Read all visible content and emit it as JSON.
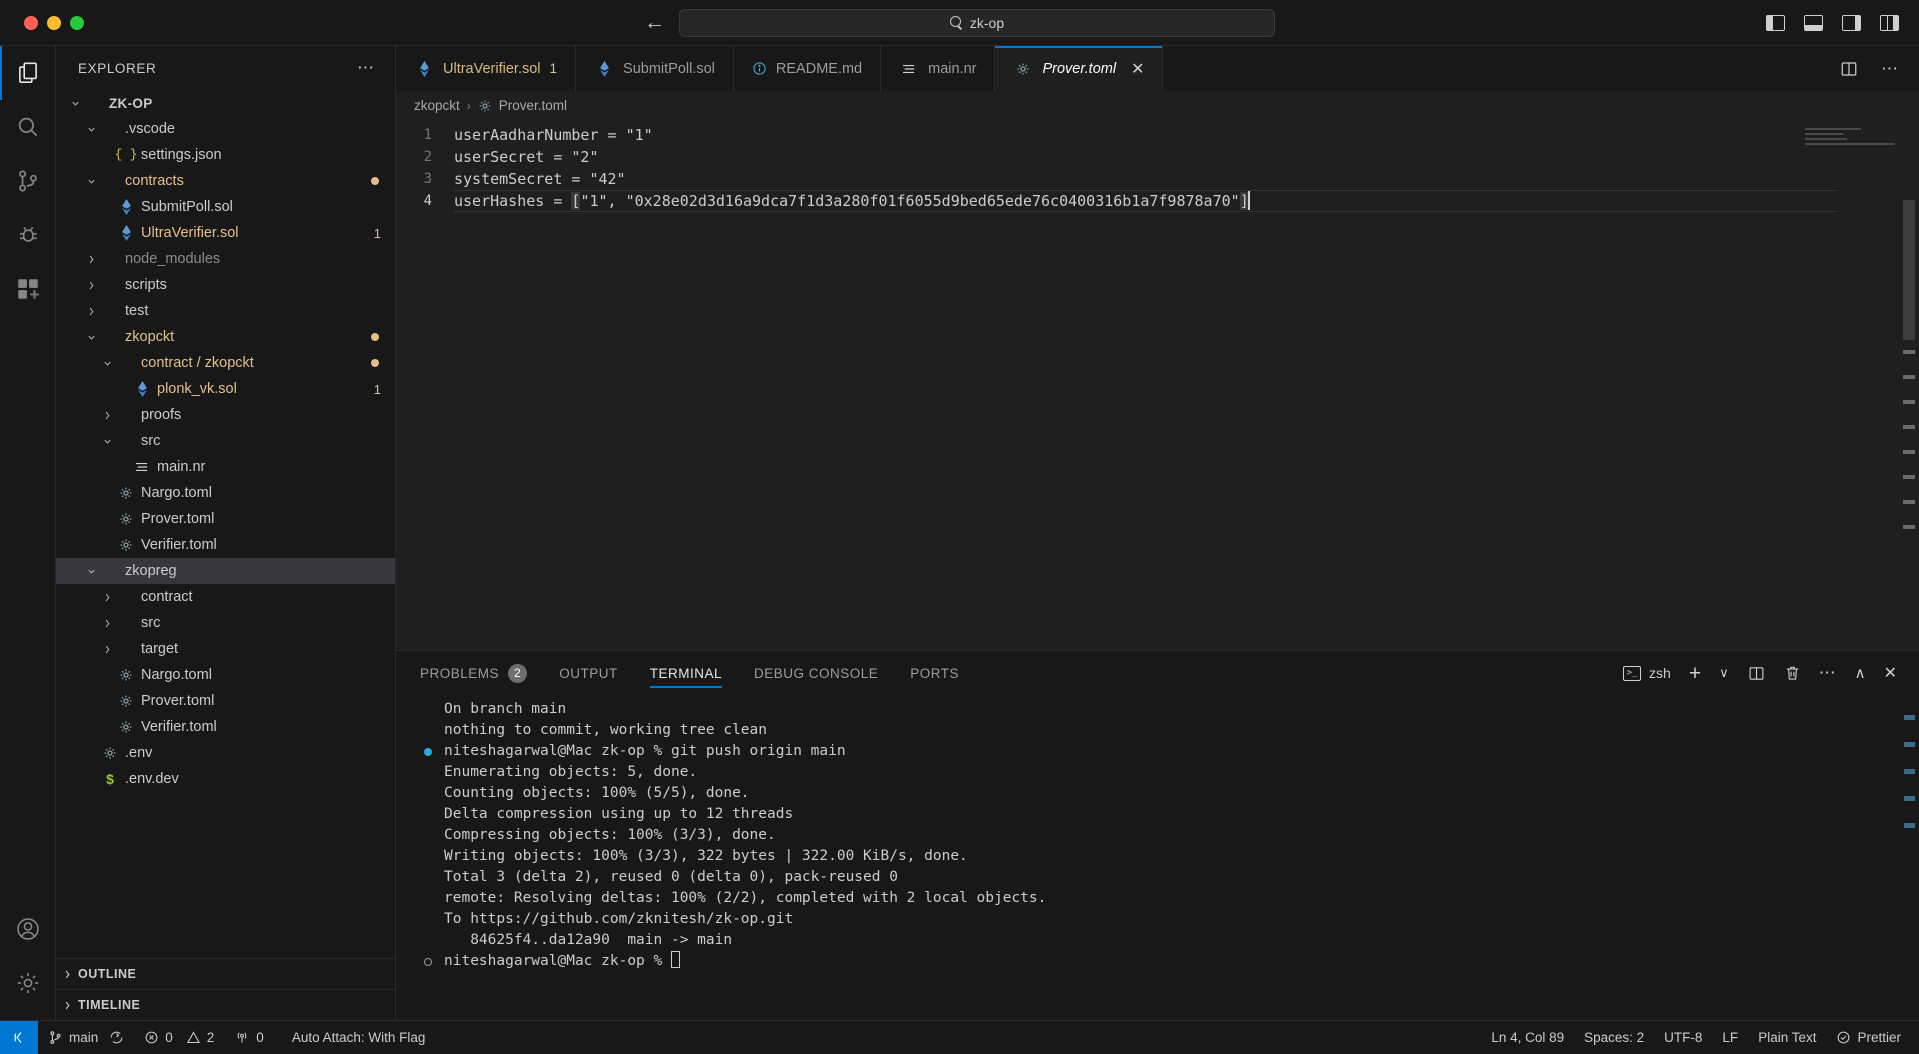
{
  "titlebar": {
    "search_text": "zk-op",
    "search_icon": "search-icon",
    "back_arrow": "←",
    "forward_arrow": "→"
  },
  "activitybar": {
    "items": [
      {
        "name": "explorer",
        "icon": "files-icon",
        "active": true
      },
      {
        "name": "search",
        "icon": "search-icon",
        "active": false
      },
      {
        "name": "source-control",
        "icon": "source-control-icon",
        "active": false
      },
      {
        "name": "run-and-debug",
        "icon": "debug-icon",
        "active": false
      },
      {
        "name": "extensions",
        "icon": "extensions-icon",
        "active": false
      }
    ],
    "bottom": [
      {
        "name": "accounts",
        "icon": "account-icon"
      },
      {
        "name": "settings",
        "icon": "gear-icon"
      }
    ]
  },
  "sidebar": {
    "title": "EXPLORER",
    "more_actions": "⋯",
    "tree": [
      {
        "label": "ZK-OP",
        "indent": 0,
        "type": "folder-root",
        "chev": "v",
        "icon": "none",
        "color": "white",
        "badge": "",
        "modified": false,
        "selected": false
      },
      {
        "label": ".vscode",
        "indent": 1,
        "type": "folder",
        "chev": "v",
        "icon": "none",
        "color": "white",
        "badge": "",
        "modified": false,
        "selected": false
      },
      {
        "label": "settings.json",
        "indent": 2,
        "type": "file",
        "chev": "",
        "icon": "json",
        "color": "white",
        "badge": "",
        "modified": false,
        "selected": false
      },
      {
        "label": "contracts",
        "indent": 1,
        "type": "folder",
        "chev": "v",
        "icon": "none",
        "color": "yellow",
        "badge": "",
        "modified": true,
        "selected": false
      },
      {
        "label": "SubmitPoll.sol",
        "indent": 2,
        "type": "file",
        "chev": "",
        "icon": "sol",
        "color": "white",
        "badge": "",
        "modified": false,
        "selected": false
      },
      {
        "label": "UltraVerifier.sol",
        "indent": 2,
        "type": "file",
        "chev": "",
        "icon": "sol",
        "color": "yellow",
        "badge": "1",
        "modified": false,
        "selected": false
      },
      {
        "label": "node_modules",
        "indent": 1,
        "type": "folder",
        "chev": ">",
        "icon": "none",
        "color": "dim",
        "badge": "",
        "modified": false,
        "selected": false
      },
      {
        "label": "scripts",
        "indent": 1,
        "type": "folder",
        "chev": ">",
        "icon": "none",
        "color": "white",
        "badge": "",
        "modified": false,
        "selected": false
      },
      {
        "label": "test",
        "indent": 1,
        "type": "folder",
        "chev": ">",
        "icon": "none",
        "color": "white",
        "badge": "",
        "modified": false,
        "selected": false
      },
      {
        "label": "zkopckt",
        "indent": 1,
        "type": "folder",
        "chev": "v",
        "icon": "none",
        "color": "yellow",
        "badge": "",
        "modified": true,
        "selected": false
      },
      {
        "label": "contract / zkopckt",
        "indent": 2,
        "type": "folder",
        "chev": "v",
        "icon": "none",
        "color": "yellow",
        "badge": "",
        "modified": true,
        "selected": false
      },
      {
        "label": "plonk_vk.sol",
        "indent": 3,
        "type": "file",
        "chev": "",
        "icon": "sol",
        "color": "yellow",
        "badge": "1",
        "modified": false,
        "selected": false
      },
      {
        "label": "proofs",
        "indent": 2,
        "type": "folder",
        "chev": ">",
        "icon": "none",
        "color": "white",
        "badge": "",
        "modified": false,
        "selected": false
      },
      {
        "label": "src",
        "indent": 2,
        "type": "folder",
        "chev": "v",
        "icon": "none",
        "color": "white",
        "badge": "",
        "modified": false,
        "selected": false
      },
      {
        "label": "main.nr",
        "indent": 3,
        "type": "file",
        "chev": "",
        "icon": "lines",
        "color": "white",
        "badge": "",
        "modified": false,
        "selected": false
      },
      {
        "label": "Nargo.toml",
        "indent": 2,
        "type": "file",
        "chev": "",
        "icon": "gear",
        "color": "white",
        "badge": "",
        "modified": false,
        "selected": false
      },
      {
        "label": "Prover.toml",
        "indent": 2,
        "type": "file",
        "chev": "",
        "icon": "gear",
        "color": "white",
        "badge": "",
        "modified": false,
        "selected": false
      },
      {
        "label": "Verifier.toml",
        "indent": 2,
        "type": "file",
        "chev": "",
        "icon": "gear",
        "color": "white",
        "badge": "",
        "modified": false,
        "selected": false
      },
      {
        "label": "zkopreg",
        "indent": 1,
        "type": "folder",
        "chev": "v",
        "icon": "none",
        "color": "white",
        "badge": "",
        "modified": false,
        "selected": true
      },
      {
        "label": "contract",
        "indent": 2,
        "type": "folder",
        "chev": ">",
        "icon": "none",
        "color": "white",
        "badge": "",
        "modified": false,
        "selected": false
      },
      {
        "label": "src",
        "indent": 2,
        "type": "folder",
        "chev": ">",
        "icon": "none",
        "color": "white",
        "badge": "",
        "modified": false,
        "selected": false
      },
      {
        "label": "target",
        "indent": 2,
        "type": "folder",
        "chev": ">",
        "icon": "none",
        "color": "white",
        "badge": "",
        "modified": false,
        "selected": false
      },
      {
        "label": "Nargo.toml",
        "indent": 2,
        "type": "file",
        "chev": "",
        "icon": "gear",
        "color": "white",
        "badge": "",
        "modified": false,
        "selected": false
      },
      {
        "label": "Prover.toml",
        "indent": 2,
        "type": "file",
        "chev": "",
        "icon": "gear",
        "color": "white",
        "badge": "",
        "modified": false,
        "selected": false
      },
      {
        "label": "Verifier.toml",
        "indent": 2,
        "type": "file",
        "chev": "",
        "icon": "gear",
        "color": "white",
        "badge": "",
        "modified": false,
        "selected": false
      },
      {
        "label": ".env",
        "indent": 1,
        "type": "file",
        "chev": "",
        "icon": "gear",
        "color": "white",
        "badge": "",
        "modified": false,
        "selected": false
      },
      {
        "label": ".env.dev",
        "indent": 1,
        "type": "file",
        "chev": "",
        "icon": "dollar",
        "color": "white",
        "badge": "",
        "modified": false,
        "selected": false
      }
    ],
    "sections": [
      {
        "label": "OUTLINE",
        "chev": ">"
      },
      {
        "label": "TIMELINE",
        "chev": ">"
      }
    ]
  },
  "tabs": [
    {
      "label": "UltraVerifier.sol",
      "icon": "solidity-icon",
      "badge": "1",
      "active": false,
      "color": "yellow",
      "closable": false
    },
    {
      "label": "SubmitPoll.sol",
      "icon": "solidity-icon",
      "badge": "",
      "active": false,
      "color": "grey",
      "closable": false
    },
    {
      "label": "README.md",
      "icon": "info-icon",
      "badge": "",
      "active": false,
      "color": "grey",
      "closable": false
    },
    {
      "label": "main.nr",
      "icon": "lines-icon",
      "badge": "",
      "active": false,
      "color": "grey",
      "closable": false
    },
    {
      "label": "Prover.toml",
      "icon": "gear-icon",
      "badge": "",
      "active": true,
      "color": "white",
      "closable": true,
      "close_label": "✕"
    }
  ],
  "tabbar_actions": {
    "split_editor": "split-editor-icon",
    "more": "⋯"
  },
  "breadcrumb": {
    "items": [
      {
        "label": "zkopckt",
        "icon": "none"
      },
      {
        "label": "Prover.toml",
        "icon": "gear"
      }
    ],
    "separator": "›"
  },
  "editor": {
    "language": "Plain Text",
    "lines": [
      {
        "num": "1",
        "text": "userAadharNumber = \"1\""
      },
      {
        "num": "2",
        "text": "userSecret = \"2\""
      },
      {
        "num": "3",
        "text": "systemSecret = \"42\""
      },
      {
        "num": "4",
        "text": "userHashes = [\"1\", \"0x28e02d3d16a9dca7f1d3a280f01f6055d9bed65ede76c0400316b1a7f9878a70\"]"
      }
    ],
    "line4_prefix": "userHashes = ",
    "line4_open_bracket": "[",
    "line4_body": "\"1\", \"0x28e02d3d16a9dca7f1d3a280f01f6055d9bed65ede76c0400316b1a7f9878a70\"",
    "line4_close_bracket": "]"
  },
  "panel": {
    "tabs": [
      {
        "label": "PROBLEMS",
        "badge": "2",
        "active": false
      },
      {
        "label": "OUTPUT",
        "badge": "",
        "active": false
      },
      {
        "label": "TERMINAL",
        "badge": "",
        "active": true
      },
      {
        "label": "DEBUG CONSOLE",
        "badge": "",
        "active": false
      },
      {
        "label": "PORTS",
        "badge": "",
        "active": false
      }
    ],
    "shell": "zsh",
    "actions": {
      "new_terminal": "+",
      "dropdown": "∨",
      "split": "split-terminal-icon",
      "kill": "trash-icon",
      "more": "⋯",
      "maximize": "∧",
      "close": "✕"
    },
    "terminal_lines": [
      {
        "text": "On branch main",
        "marker": ""
      },
      {
        "text": "nothing to commit, working tree clean",
        "marker": ""
      },
      {
        "text": "niteshagarwal@Mac zk-op % git push origin main",
        "marker": "filled"
      },
      {
        "text": "Enumerating objects: 5, done.",
        "marker": ""
      },
      {
        "text": "Counting objects: 100% (5/5), done.",
        "marker": ""
      },
      {
        "text": "Delta compression using up to 12 threads",
        "marker": ""
      },
      {
        "text": "Compressing objects: 100% (3/3), done.",
        "marker": ""
      },
      {
        "text": "Writing objects: 100% (3/3), 322 bytes | 322.00 KiB/s, done.",
        "marker": ""
      },
      {
        "text": "Total 3 (delta 2), reused 0 (delta 0), pack-reused 0",
        "marker": ""
      },
      {
        "text": "remote: Resolving deltas: 100% (2/2), completed with 2 local objects.",
        "marker": ""
      },
      {
        "text": "To https://github.com/zknitesh/zk-op.git",
        "marker": ""
      },
      {
        "text": "   84625f4..da12a90  main -> main",
        "marker": ""
      },
      {
        "text": "niteshagarwal@Mac zk-op % ",
        "marker": "hollow",
        "caret": true
      }
    ]
  },
  "statusbar": {
    "remote_icon": "remote-window-icon",
    "branch": "main",
    "sync_icon": "sync-icon",
    "errors": "0",
    "warnings": "2",
    "ports": "0",
    "auto_attach": "Auto Attach: With Flag",
    "cursor_position": "Ln 4, Col 89",
    "indentation": "Spaces: 2",
    "encoding": "UTF-8",
    "eol": "LF",
    "language": "Plain Text",
    "formatter": "Prettier",
    "formatter_icon": "prettier-check-icon"
  },
  "colors": {
    "accent": "#0078d4",
    "modified_folder": "#e2c08d",
    "bg": "#1f1f1f",
    "chrome_bg": "#181818",
    "selection": "#37373d"
  }
}
